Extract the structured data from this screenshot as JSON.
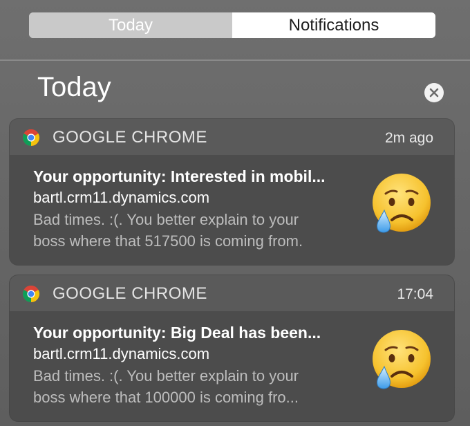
{
  "tabs": {
    "today": "Today",
    "notifications": "Notifications"
  },
  "header": {
    "title": "Today"
  },
  "notifications": [
    {
      "app": "GOOGLE CHROME",
      "time": "2m ago",
      "title": "Your opportunity: Interested in mobil...",
      "subtitle": "bartl.crm11.dynamics.com",
      "line1": "Bad times.  :(. You better explain to your",
      "line2": "boss where that 517500 is coming from.",
      "icon": "chrome-icon",
      "image": "crying-face-icon"
    },
    {
      "app": "GOOGLE CHROME",
      "time": "17:04",
      "title": "Your opportunity: Big Deal has been...",
      "subtitle": "bartl.crm11.dynamics.com",
      "line1": "Bad times.  :(. You better explain to your",
      "line2": "boss where that 100000 is coming fro...",
      "icon": "chrome-icon",
      "image": "crying-face-icon"
    }
  ]
}
